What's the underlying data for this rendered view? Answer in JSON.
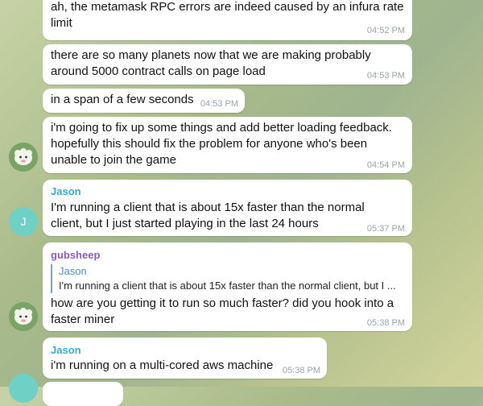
{
  "messages": [
    {
      "text": "ah, the metamask RPC errors are indeed caused by an infura rate\nlimit",
      "time": "04:52 PM"
    },
    {
      "text": "there are so many planets now that we are making probably\naround 5000 contract calls on page load",
      "time": "04:53 PM"
    },
    {
      "text": "in a span of a few seconds",
      "time": "04:53 PM"
    },
    {
      "text": "i'm going to fix up some things and add better loading feedback.\nhopefully this should fix the problem for anyone who's been\nunable to join the game",
      "time": "04:54 PM"
    },
    {
      "sender": "Jason",
      "sender_color": "#3aa9c9",
      "text": "I'm running a client that is about 15x faster than the normal\nclient, but I just started playing in the last 24 hours",
      "time": "05:37 PM"
    },
    {
      "sender": "gubsheep",
      "sender_color": "#8a5bbf",
      "reply_to": {
        "name": "Jason",
        "text": "I'm running a client that is about 15x faster than the normal client, but I ..."
      },
      "text": "how are you getting it to run so much faster? did you hook into a\nfaster miner",
      "time": "05:38 PM"
    },
    {
      "sender": "Jason",
      "sender_color": "#3aa9c9",
      "text": "i'm running on a multi-cored aws machine",
      "time": "05:38 PM"
    }
  ],
  "avatars": {
    "gubsheep_icon": "sheep-icon",
    "jason_initial": "J"
  }
}
